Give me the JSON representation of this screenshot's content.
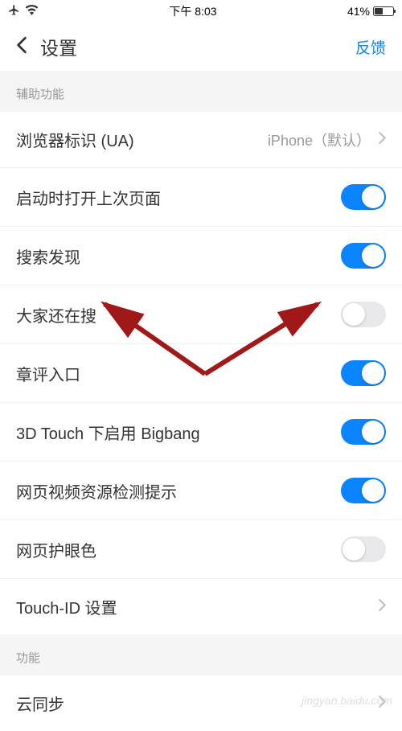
{
  "status": {
    "time": "下午 8:03",
    "battery_pct": "41%"
  },
  "nav": {
    "title": "设置",
    "feedback": "反馈"
  },
  "sections": {
    "accessibility": "辅助功能",
    "features": "功能"
  },
  "rows": {
    "ua": {
      "label": "浏览器标识 (UA)",
      "value": "iPhone（默认）"
    },
    "restore_tabs": {
      "label": "启动时打开上次页面",
      "on": true
    },
    "search_discovery": {
      "label": "搜索发现",
      "on": true
    },
    "people_searching": {
      "label": "大家还在搜",
      "on": false
    },
    "chapter_comments": {
      "label": "章评入口",
      "on": true
    },
    "bigbang": {
      "label": "3D Touch 下启用 Bigbang",
      "on": true
    },
    "video_detect": {
      "label": "网页视频资源检测提示",
      "on": true
    },
    "eye_protect": {
      "label": "网页护眼色",
      "on": false
    },
    "touch_id": {
      "label": "Touch-ID 设置"
    },
    "cloud_sync": {
      "label": "云同步"
    }
  },
  "watermark": "jingyan.baidu.com"
}
